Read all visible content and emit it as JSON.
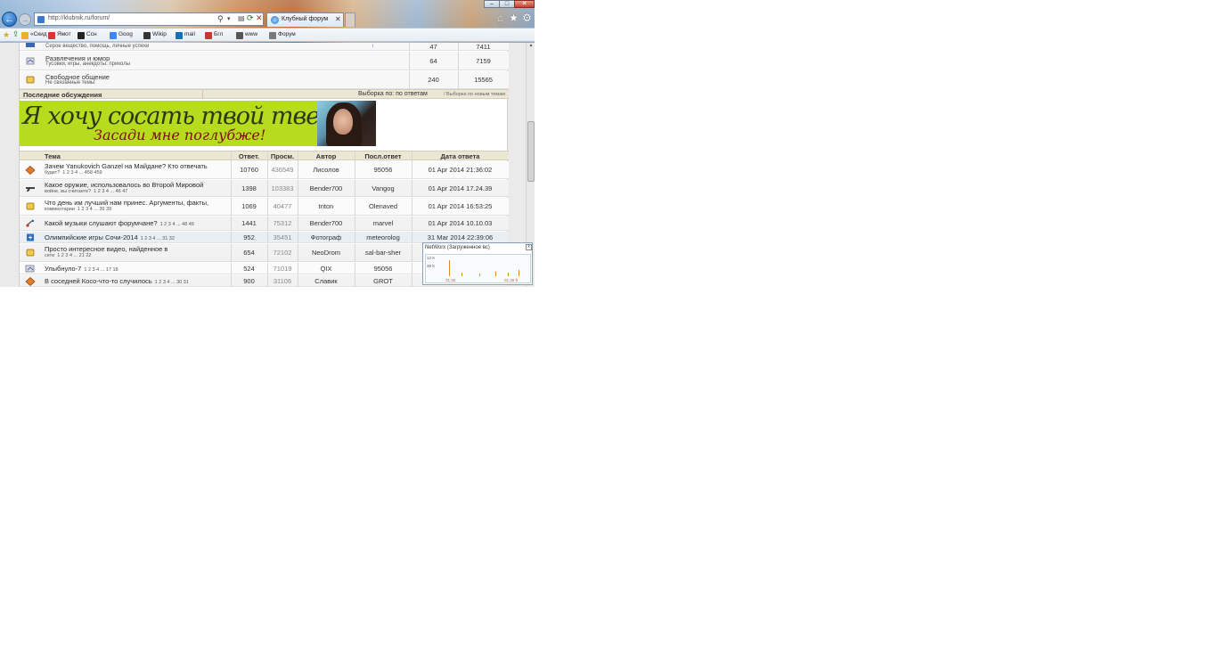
{
  "window": {
    "controls": {
      "minimize": "–",
      "maximize": "□",
      "close": "✕"
    }
  },
  "addressbar": {
    "url": "http://klubnik.ru/forum/",
    "search_icon": "⚲",
    "dropdown_icon": "▾",
    "refresh_icon": "⟳",
    "stop_icon": "✕",
    "compat_icon": "▤"
  },
  "tabs": [
    {
      "label": "Клубный форум",
      "close": "✕"
    }
  ],
  "right_icons": {
    "home": "⌂",
    "favorites": "★",
    "tools": "⚙"
  },
  "favorites_bar": {
    "items": [
      {
        "label": "«Скид"
      },
      {
        "label": "Ямот"
      },
      {
        "label": "Ссн"
      },
      {
        "label": "Goog"
      },
      {
        "label": "Wikip"
      },
      {
        "label": "mail"
      },
      {
        "label": "Бгл"
      },
      {
        "label": "www"
      },
      {
        "label": "Форум"
      }
    ]
  },
  "categories": [
    {
      "title": "",
      "desc": "Серое вещество, помощь, личные успехи",
      "topics": "47",
      "posts": "7411"
    },
    {
      "title": "Развлечения и юмор",
      "desc": "Тусовки, игры, анекдоты, приколы",
      "topics": "64",
      "posts": "7159"
    },
    {
      "title": "Свободное общение",
      "desc": "Не связанные темы",
      "topics": "240",
      "posts": "15565"
    }
  ],
  "latest": {
    "title": "Последние обсуждения",
    "filter": "Выборка по: по ответам",
    "filter2": "/ Выборка по новым темам"
  },
  "ad": {
    "line1": "Я хочу сосать твой твердый член!",
    "line2": "Засади мне поглубже!",
    "marker": "i"
  },
  "topics_table": {
    "headers": {
      "topic": "Тема",
      "replies": "Ответ.",
      "views": "Просм.",
      "author": "Автор",
      "last_poster": "Посл.ответ",
      "date": "Дата ответа"
    },
    "rows": [
      {
        "title": "Зачем Yanukovich Ganzel на Майдане? Кто отвечать",
        "line2": "будет?",
        "pages": "1 2 3 4 ... 458 459",
        "replies": "10760",
        "views": "436549",
        "author": "Лисолов",
        "last": "95056",
        "date": "01 Apr 2014 21:36:02"
      },
      {
        "title": "Какое оружие, использовалось во Второй Мировой",
        "line2": "войне, вы считаете?",
        "pages": "1 2 3 4 ... 46 47",
        "replies": "1398",
        "views": "103383",
        "author": "Bender700",
        "last": "Vangog",
        "date": "01 Apr 2014 17.24.39"
      },
      {
        "title": "Что день им лучший нам принес. Аргументы, факты,",
        "line2": "комментарии",
        "pages": "1 2 3 4 ... 39 39",
        "replies": "1069",
        "views": "40477",
        "author": "triton",
        "last": "Olenaved",
        "date": "01 Apr 2014 16:53:25"
      },
      {
        "title": "Какой музыки слушают форумчане?",
        "line2": "",
        "pages": "1 2 3 4 ... 48 49",
        "replies": "1441",
        "views": "75312",
        "author": "Bender700",
        "last": "marvel",
        "date": "01 Apr 2014 10.10.03"
      },
      {
        "title": "Олимпийские игры Сочи-2014",
        "line2": "",
        "pages": "1 2 3 4 ... 31 32",
        "replies": "952",
        "views": "35451",
        "author": "Фотограф",
        "last": "meteorolog",
        "date": "31 Mar 2014 22:39:06"
      },
      {
        "title": "Просто интересное видео, найденное в",
        "line2": "сети",
        "pages": "1 2 3 4 ... 21 22",
        "replies": "654",
        "views": "72102",
        "author": "NeoDrom",
        "last": "sal-bar-sher",
        "date": ""
      },
      {
        "title": "Улыбнуло-7",
        "line2": "",
        "pages": "1 2 3 4 ... 17 18",
        "replies": "524",
        "views": "71019",
        "author": "QIX",
        "last": "95056",
        "date": ""
      },
      {
        "title": "В соседней Косо-что-то случилось",
        "line2": "",
        "pages": "1 2 3 4 ... 30 31",
        "replies": "900",
        "views": "31106",
        "author": "Славик",
        "last": "GROT",
        "date": ""
      }
    ]
  },
  "networx": {
    "title": "NetWorx (Загруженное вс)",
    "close": "x",
    "label_top": "12 K",
    "label_mid": "35 K",
    "time1": "21:30",
    "time2": "01:30 ft"
  },
  "colors": {
    "ad_bg": "#b7dc1e",
    "table_header_bg": "#ece6d4",
    "accent_link": "#2a2a2a"
  }
}
